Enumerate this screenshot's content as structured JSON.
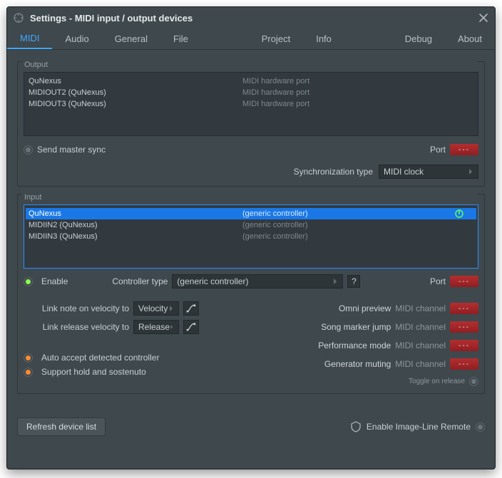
{
  "window": {
    "title": "Settings - MIDI input / output devices"
  },
  "tabs": {
    "midi": "MIDI",
    "audio": "Audio",
    "general": "General",
    "file": "File",
    "project": "Project",
    "info": "Info",
    "debug": "Debug",
    "about": "About"
  },
  "output": {
    "title": "Output",
    "rows": [
      {
        "name": "QuNexus",
        "desc": "MIDI hardware port"
      },
      {
        "name": "MIDIOUT2 (QuNexus)",
        "desc": "MIDI hardware port"
      },
      {
        "name": "MIDIOUT3 (QuNexus)",
        "desc": "MIDI hardware port"
      }
    ],
    "send_master_sync": "Send master sync",
    "port_label": "Port",
    "port_value": "---",
    "sync_type_label": "Synchronization type",
    "sync_type_value": "MIDI clock"
  },
  "input": {
    "title": "Input",
    "rows": [
      {
        "name": "QuNexus",
        "desc": "(generic controller)",
        "selected": true
      },
      {
        "name": "MIDIIN2 (QuNexus)",
        "desc": "(generic controller)"
      },
      {
        "name": "MIDIIN3 (QuNexus)",
        "desc": "(generic controller)"
      }
    ],
    "enable": "Enable",
    "ctrl_type_label": "Controller type",
    "ctrl_type_value": "(generic controller)",
    "help": "?",
    "port_label": "Port",
    "port_value": "---",
    "link_note_on": "Link note on velocity to",
    "link_release": "Link release velocity to",
    "velocity_value": "Velocity",
    "release_value": "Release",
    "auto_accept": "Auto accept detected controller",
    "support_hold": "Support hold and sostenuto",
    "side": {
      "omni": {
        "a": "Omni preview",
        "b": "MIDI channel",
        "v": "---"
      },
      "marker": {
        "a": "Song marker jump",
        "b": "MIDI channel",
        "v": "---"
      },
      "perf": {
        "a": "Performance mode",
        "b": "MIDI channel",
        "v": "---"
      },
      "mute": {
        "a": "Generator muting",
        "b": "MIDI channel",
        "v": "---"
      }
    },
    "toggle_note": "Toggle on release"
  },
  "footer": {
    "refresh": "Refresh device list",
    "il_remote": "Enable Image-Line Remote"
  }
}
